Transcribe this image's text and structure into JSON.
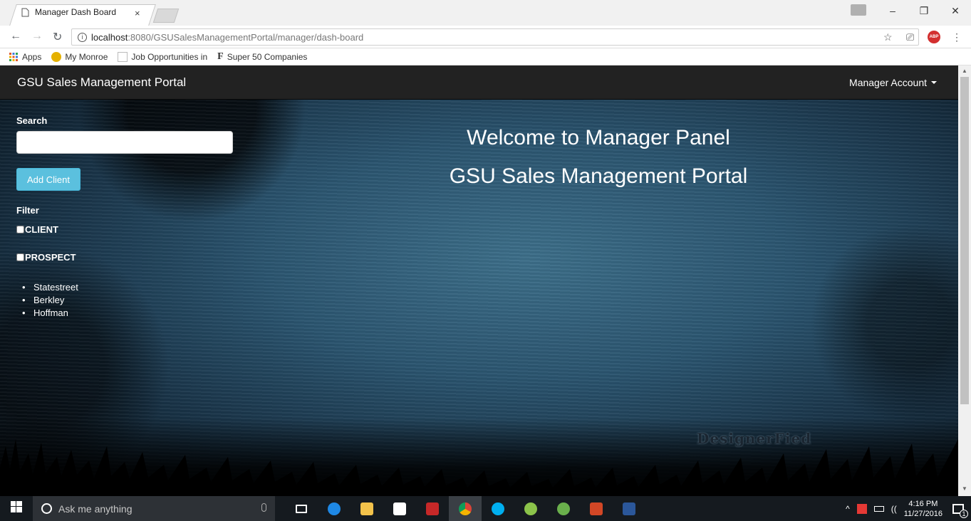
{
  "browser": {
    "tab_title": "Manager Dash Board",
    "tab_close": "×",
    "url_host": "localhost",
    "url_rest": ":8080/GSUSalesManagementPortal/manager/dash-board",
    "bookmarks": [
      "Apps",
      "My Monroe",
      "Job Opportunities in",
      "Super 50 Companies"
    ],
    "abp_label": "ABP"
  },
  "navbar": {
    "brand": "GSU Sales Management Portal",
    "account": "Manager Account"
  },
  "sidebar": {
    "search_label": "Search",
    "search_value": "",
    "add_client_label": "Add Client",
    "filter_label": "Filter",
    "filter_options": [
      "CLIENT",
      "PROSPECT"
    ],
    "clients": [
      "Statestreet",
      "Berkley",
      "Hoffman"
    ]
  },
  "hero": {
    "line1": "Welcome to Manager Panel",
    "line2": "GSU Sales Management Portal"
  },
  "watermark": "DesignerFied",
  "taskbar": {
    "search_placeholder": "Ask me anything",
    "time": "4:16 PM",
    "date": "11/27/2016",
    "notification_count": "1"
  },
  "colors": {
    "navbar_bg": "#222222",
    "info_button": "#5bc0de",
    "page_bg": "#2b5570"
  }
}
